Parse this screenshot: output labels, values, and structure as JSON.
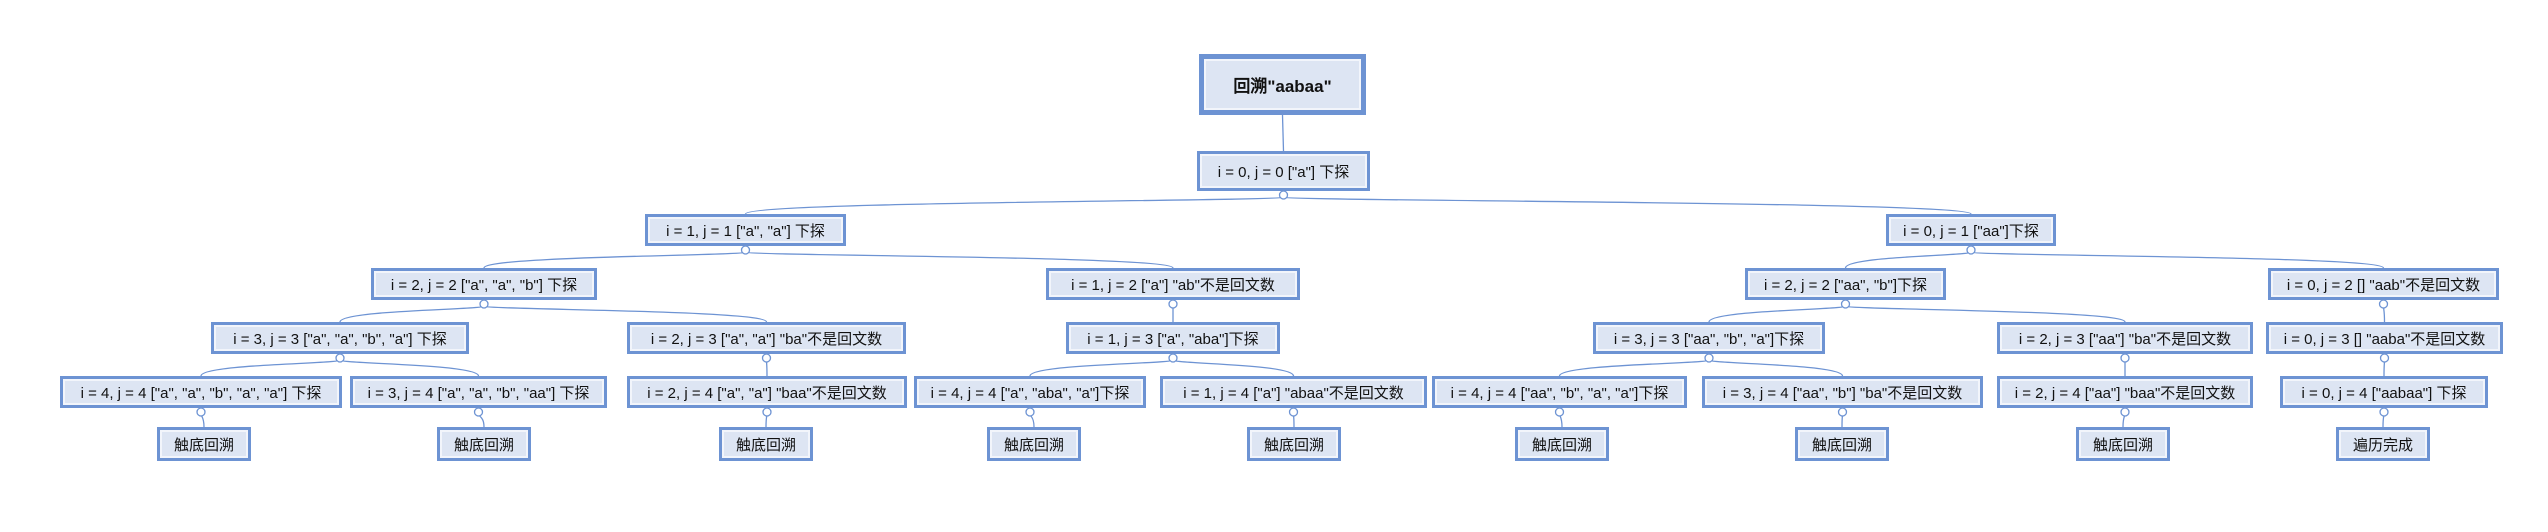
{
  "diagram": {
    "root": {
      "id": "root",
      "label": "回溯\"aabaa\""
    },
    "nodes": [
      {
        "id": "n0",
        "label": "i = 0, j = 0 [\"a\"] 下探",
        "parent": "root"
      },
      {
        "id": "n1",
        "label": "i = 1, j = 1 [\"a\", \"a\"] 下探",
        "parent": "n0"
      },
      {
        "id": "n2",
        "label": "i = 0, j = 1 [\"aa\"]下探",
        "parent": "n0"
      },
      {
        "id": "n3",
        "label": "i = 2, j = 2 [\"a\", \"a\", \"b\"] 下探",
        "parent": "n1"
      },
      {
        "id": "n4",
        "label": "i = 1, j = 2 [\"a\"] \"ab\"不是回文数",
        "parent": "n1"
      },
      {
        "id": "n5",
        "label": "i = 2, j = 2 [\"aa\", \"b\"]下探",
        "parent": "n2"
      },
      {
        "id": "n6",
        "label": "i = 0, j = 2 [] \"aab\"不是回文数",
        "parent": "n2"
      },
      {
        "id": "n7",
        "label": "i = 3, j = 3 [\"a\", \"a\", \"b\", \"a\"] 下探",
        "parent": "n3"
      },
      {
        "id": "n8",
        "label": "i = 2, j = 3 [\"a\", \"a\"] \"ba\"不是回文数",
        "parent": "n3"
      },
      {
        "id": "n9",
        "label": "i = 1, j = 3 [\"a\", \"aba\"]下探",
        "parent": "n4"
      },
      {
        "id": "n10",
        "label": "i = 3, j = 3 [\"aa\", \"b\", \"a\"]下探",
        "parent": "n5"
      },
      {
        "id": "n11",
        "label": "i = 2, j = 3 [\"aa\"] \"ba\"不是回文数",
        "parent": "n5"
      },
      {
        "id": "n12",
        "label": "i = 0, j = 3 [] \"aaba\"不是回文数",
        "parent": "n6"
      },
      {
        "id": "n13",
        "label": "i = 4, j = 4 [\"a\", \"a\", \"b\", \"a\", \"a\"] 下探",
        "parent": "n7"
      },
      {
        "id": "n14",
        "label": "i = 3, j = 4 [\"a\", \"a\", \"b\", \"aa\"] 下探",
        "parent": "n7"
      },
      {
        "id": "n15",
        "label": "i = 2, j = 4 [\"a\", \"a\"] \"baa\"不是回文数",
        "parent": "n8"
      },
      {
        "id": "n16",
        "label": "i = 4, j = 4 [\"a\", \"aba\", \"a\"]下探",
        "parent": "n9"
      },
      {
        "id": "n17",
        "label": "i = 1, j = 4 [\"a\"] \"abaa\"不是回文数",
        "parent": "n9"
      },
      {
        "id": "n18",
        "label": "i = 4, j = 4 [\"aa\", \"b\", \"a\", \"a\"]下探",
        "parent": "n10"
      },
      {
        "id": "n19",
        "label": "i = 3, j = 4 [\"aa\", \"b\"] \"ba\"不是回文数",
        "parent": "n10"
      },
      {
        "id": "n20",
        "label": "i = 2, j = 4 [\"aa\"] \"baa\"不是回文数",
        "parent": "n11"
      },
      {
        "id": "n21",
        "label": "i = 0, j = 4 [\"aabaa\"] 下探",
        "parent": "n12"
      },
      {
        "id": "l1",
        "label": "触底回溯",
        "parent": "n13"
      },
      {
        "id": "l2",
        "label": "触底回溯",
        "parent": "n14"
      },
      {
        "id": "l3",
        "label": "触底回溯",
        "parent": "n15"
      },
      {
        "id": "l4",
        "label": "触底回溯",
        "parent": "n16"
      },
      {
        "id": "l5",
        "label": "触底回溯",
        "parent": "n17"
      },
      {
        "id": "l6",
        "label": "触底回溯",
        "parent": "n18"
      },
      {
        "id": "l7",
        "label": "触底回溯",
        "parent": "n19"
      },
      {
        "id": "l8",
        "label": "触底回溯",
        "parent": "n20"
      },
      {
        "id": "l9",
        "label": "遍历完成",
        "parent": "n21"
      }
    ]
  }
}
